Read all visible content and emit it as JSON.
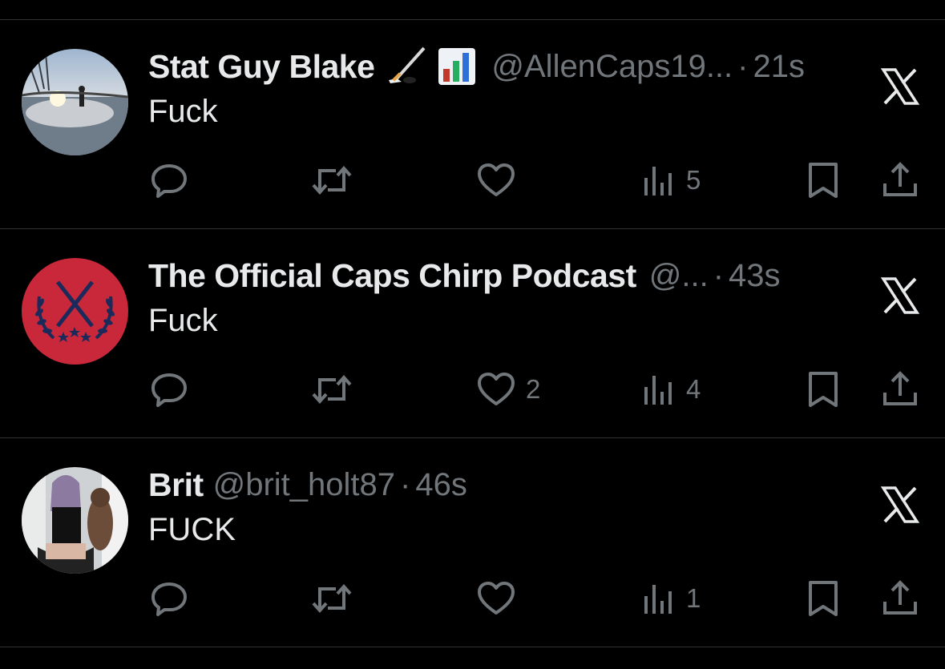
{
  "posts": [
    {
      "display_name": "Stat Guy Blake",
      "name_emoji": [
        "hockey-stick-icon",
        "bar-chart-icon"
      ],
      "handle": "@AllenCaps19...",
      "dot": "·",
      "time": "21s",
      "text": "Fuck",
      "avatar": "frozen-pond-skater-photo",
      "actions": {
        "replies": "",
        "reposts": "",
        "likes": "",
        "views": "5"
      }
    },
    {
      "display_name": "The Official Caps Chirp Podcast",
      "name_emoji": [],
      "handle": "@...",
      "dot": "·",
      "time": "43s",
      "text": "Fuck",
      "avatar": "red-laurel-hockey-sticks-logo",
      "actions": {
        "replies": "",
        "reposts": "",
        "likes": "2",
        "views": "4"
      }
    },
    {
      "display_name": "Brit",
      "name_emoji": [],
      "handle": "@brit_holt87",
      "dot": "·",
      "time": "46s",
      "text": "FUCK",
      "avatar": "person-with-dog-photo",
      "actions": {
        "replies": "",
        "reposts": "",
        "likes": "",
        "views": "1"
      }
    }
  ],
  "colors": {
    "background": "#000000",
    "text_primary": "#e7e9ea",
    "text_secondary": "#71767b",
    "divider": "#2f3336",
    "caps_red": "#c8102e",
    "caps_navy": "#041e42"
  }
}
